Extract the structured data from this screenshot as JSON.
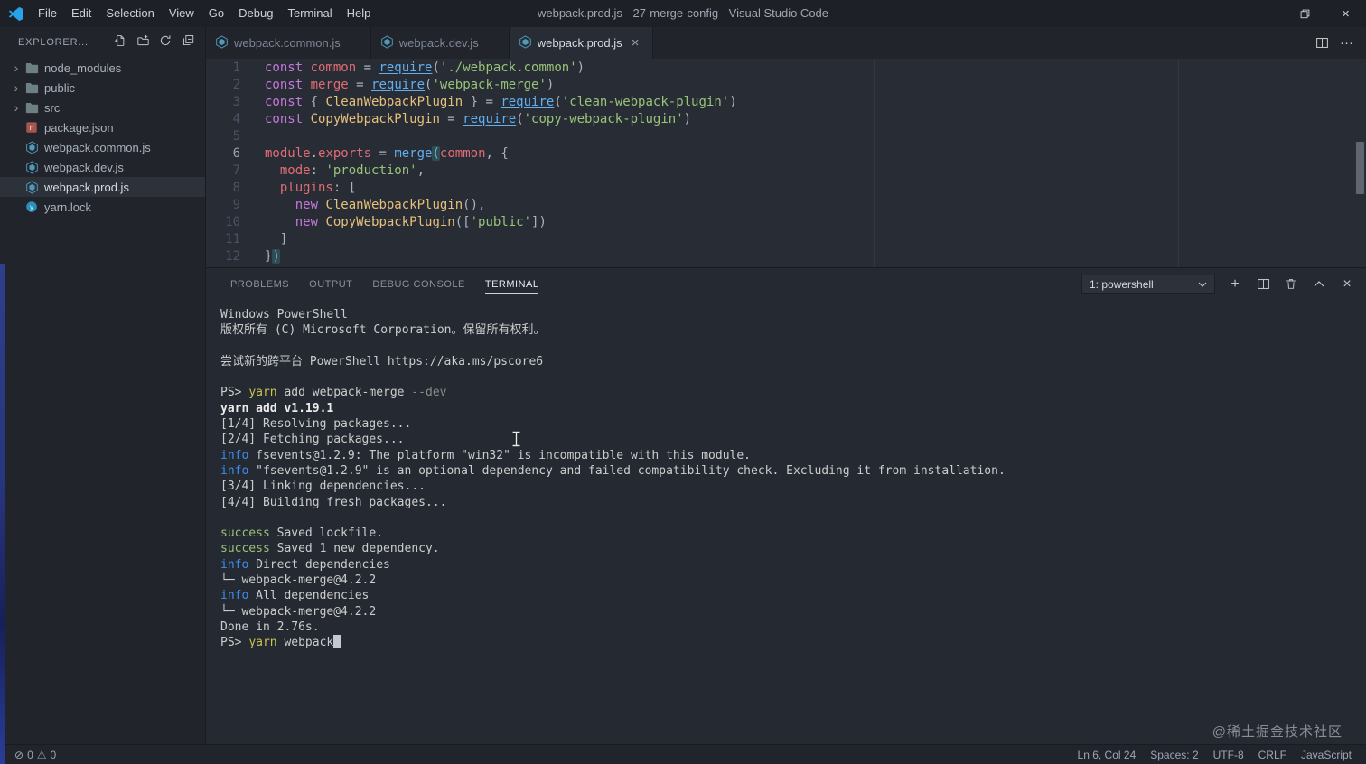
{
  "titlebar": {
    "title": "webpack.prod.js - 27-merge-config - Visual Studio Code",
    "menus": [
      "File",
      "Edit",
      "Selection",
      "View",
      "Go",
      "Debug",
      "Terminal",
      "Help"
    ]
  },
  "explorer": {
    "header": "EXPLORER...",
    "actions": [
      "new-file",
      "new-folder",
      "refresh",
      "collapse-all"
    ],
    "items": [
      {
        "label": "node_modules",
        "kind": "folder"
      },
      {
        "label": "public",
        "kind": "folder"
      },
      {
        "label": "src",
        "kind": "folder"
      },
      {
        "label": "package.json",
        "kind": "json"
      },
      {
        "label": "webpack.common.js",
        "kind": "webpack"
      },
      {
        "label": "webpack.dev.js",
        "kind": "webpack"
      },
      {
        "label": "webpack.prod.js",
        "kind": "webpack",
        "selected": true
      },
      {
        "label": "yarn.lock",
        "kind": "yarn"
      }
    ]
  },
  "editor": {
    "tabs": [
      {
        "label": "webpack.common.js",
        "active": false
      },
      {
        "label": "webpack.dev.js",
        "active": false
      },
      {
        "label": "webpack.prod.js",
        "active": true
      }
    ],
    "active_line": 6,
    "lines": [
      [
        [
          "k",
          "const "
        ],
        [
          "v",
          "common"
        ],
        [
          "p",
          " = "
        ],
        [
          "r",
          "require"
        ],
        [
          "p",
          "("
        ],
        [
          "s",
          "'./webpack.common'"
        ],
        [
          "p",
          ")"
        ]
      ],
      [
        [
          "k",
          "const "
        ],
        [
          "v",
          "merge"
        ],
        [
          "p",
          " = "
        ],
        [
          "r",
          "require"
        ],
        [
          "p",
          "("
        ],
        [
          "s",
          "'webpack-merge'"
        ],
        [
          "p",
          ")"
        ]
      ],
      [
        [
          "k",
          "const "
        ],
        [
          "p",
          "{ "
        ],
        [
          "c",
          "CleanWebpackPlugin"
        ],
        [
          "p",
          " } = "
        ],
        [
          "r",
          "require"
        ],
        [
          "p",
          "("
        ],
        [
          "s",
          "'clean-webpack-plugin'"
        ],
        [
          "p",
          ")"
        ]
      ],
      [
        [
          "k",
          "const "
        ],
        [
          "c",
          "CopyWebpackPlugin"
        ],
        [
          "p",
          " = "
        ],
        [
          "r",
          "require"
        ],
        [
          "p",
          "("
        ],
        [
          "s",
          "'copy-webpack-plugin'"
        ],
        [
          "p",
          ")"
        ]
      ],
      [],
      [
        [
          "v",
          "module"
        ],
        [
          "p",
          "."
        ],
        [
          "v",
          "exports"
        ],
        [
          "p",
          " = "
        ],
        [
          "f",
          "merge"
        ],
        [
          "bm",
          "("
        ],
        [
          "v",
          "common"
        ],
        [
          "p",
          ", {"
        ]
      ],
      [
        [
          "p",
          "  "
        ],
        [
          "v",
          "mode"
        ],
        [
          "p",
          ": "
        ],
        [
          "s",
          "'production'"
        ],
        [
          "p",
          ","
        ]
      ],
      [
        [
          "p",
          "  "
        ],
        [
          "v",
          "plugins"
        ],
        [
          "p",
          ": ["
        ]
      ],
      [
        [
          "p",
          "    "
        ],
        [
          "k",
          "new "
        ],
        [
          "c",
          "CleanWebpackPlugin"
        ],
        [
          "p",
          "(),"
        ]
      ],
      [
        [
          "p",
          "    "
        ],
        [
          "k",
          "new "
        ],
        [
          "c",
          "CopyWebpackPlugin"
        ],
        [
          "p",
          "(["
        ],
        [
          "s",
          "'public'"
        ],
        [
          "p",
          "])"
        ]
      ],
      [
        [
          "p",
          "  ]"
        ]
      ],
      [
        [
          "p",
          "}"
        ],
        [
          "bm",
          ")"
        ]
      ]
    ]
  },
  "panel": {
    "tabs": [
      {
        "label": "PROBLEMS",
        "active": false
      },
      {
        "label": "OUTPUT",
        "active": false
      },
      {
        "label": "DEBUG CONSOLE",
        "active": false
      },
      {
        "label": "TERMINAL",
        "active": true
      }
    ],
    "shell_select": "1: powershell",
    "terminal": [
      [
        [
          "d",
          "Windows PowerShell"
        ]
      ],
      [
        [
          "d",
          "版权所有 (C) Microsoft Corporation。保留所有权利。"
        ]
      ],
      [],
      [
        [
          "d",
          "尝试新的跨平台 PowerShell https://aka.ms/pscore6"
        ]
      ],
      [],
      [
        [
          "d",
          "PS> "
        ],
        [
          "y",
          "yarn"
        ],
        [
          "d",
          " add webpack-merge "
        ],
        [
          "gr",
          "--dev"
        ]
      ],
      [
        [
          "b",
          "yarn add v1.19.1"
        ]
      ],
      [
        [
          "d",
          "[1/4] Resolving packages..."
        ]
      ],
      [
        [
          "d",
          "[2/4] Fetching packages..."
        ]
      ],
      [
        [
          "i",
          "info"
        ],
        [
          "d",
          " fsevents@1.2.9: The platform \"win32\" is incompatible with this module."
        ]
      ],
      [
        [
          "i",
          "info"
        ],
        [
          "d",
          " \"fsevents@1.2.9\" is an optional dependency and failed compatibility check. Excluding it from installation."
        ]
      ],
      [
        [
          "d",
          "[3/4] Linking dependencies..."
        ]
      ],
      [
        [
          "d",
          "[4/4] Building fresh packages..."
        ]
      ],
      [],
      [
        [
          "g",
          "success"
        ],
        [
          "d",
          " Saved lockfile."
        ]
      ],
      [
        [
          "g",
          "success"
        ],
        [
          "d",
          " Saved 1 new dependency."
        ]
      ],
      [
        [
          "i",
          "info"
        ],
        [
          "d",
          " Direct dependencies"
        ]
      ],
      [
        [
          "d",
          "└─ webpack-merge@4.2.2"
        ]
      ],
      [
        [
          "i",
          "info"
        ],
        [
          "d",
          " All dependencies"
        ]
      ],
      [
        [
          "d",
          "└─ webpack-merge@4.2.2"
        ]
      ],
      [
        [
          "d",
          "Done in 2.76s."
        ]
      ],
      [
        [
          "d",
          "PS> "
        ],
        [
          "y",
          "yarn"
        ],
        [
          "d",
          " webpack"
        ],
        [
          "cur",
          ""
        ]
      ]
    ]
  },
  "statusbar": {
    "left": [
      {
        "icon": "circle-slash-icon",
        "count": "0"
      },
      {
        "icon": "warning-icon",
        "count": "0"
      }
    ],
    "right": [
      "Ln 6, Col 24",
      "Spaces: 2",
      "UTF-8",
      "CRLF",
      "JavaScript"
    ]
  },
  "watermark": "@稀土掘金技术社区",
  "colors": {
    "editor_bg": "#282c34",
    "sidebar_bg": "#21252b",
    "titlebar_bg": "#1d2026",
    "webpack_icon_blue": "#519aba",
    "keyword": "#c678dd",
    "variable": "#e06c75",
    "class_name": "#e5c07b",
    "string": "#98c379",
    "function": "#61afef",
    "terminal_info": "#3b8eea",
    "terminal_success": "#98c379"
  }
}
